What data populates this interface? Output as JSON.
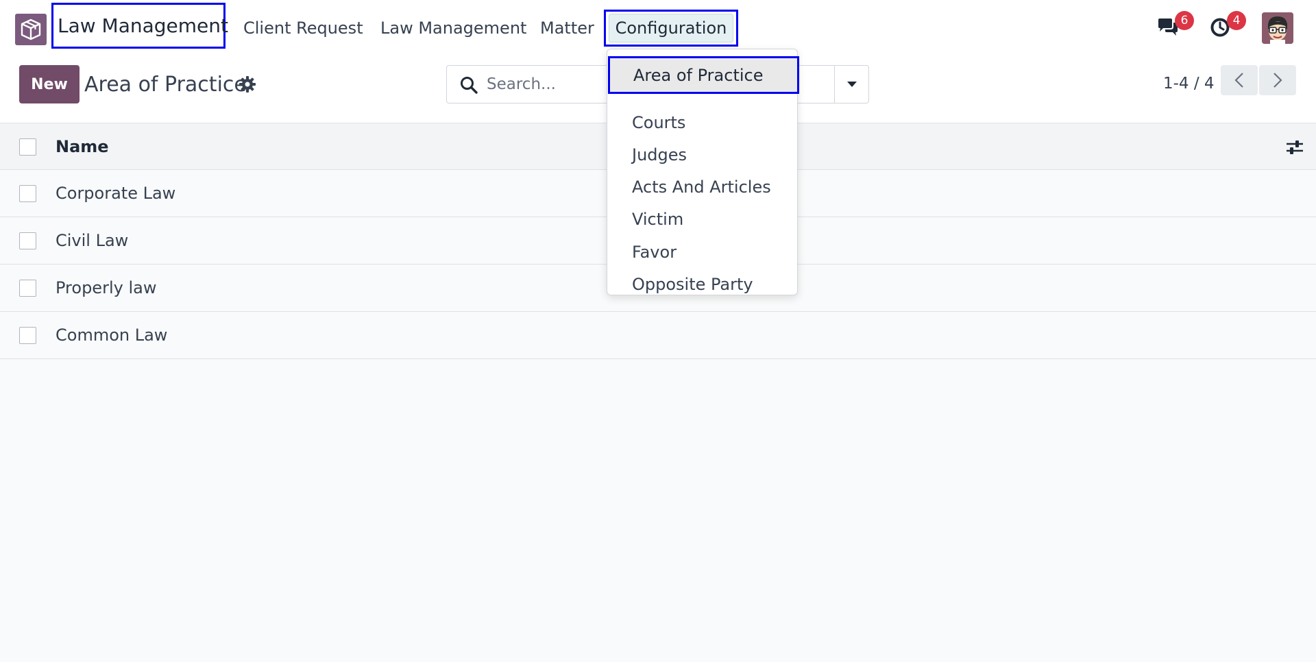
{
  "navbar": {
    "app_icon": "box-logo-icon",
    "brand": "Law Management",
    "menu": [
      {
        "label": "Client Request"
      },
      {
        "label": "Law Management"
      },
      {
        "label": "Matter"
      },
      {
        "label": "Configuration"
      }
    ],
    "messages_badge": "6",
    "activities_badge": "4",
    "icons": {
      "messages": "chat-bubbles-icon",
      "activities": "clock-icon",
      "avatar": "user-avatar"
    }
  },
  "control_panel": {
    "new_label": "New",
    "title": "Area of Practice",
    "search_placeholder": "Search...",
    "pager": "1-4 / 4"
  },
  "list": {
    "header": "Name",
    "rows": [
      {
        "name": "Corporate Law"
      },
      {
        "name": "Civil Law"
      },
      {
        "name": "Properly law"
      },
      {
        "name": "Common Law"
      }
    ]
  },
  "dropdown": {
    "items": [
      {
        "label": "Area of Practice"
      },
      {
        "label": "Courts"
      },
      {
        "label": "Judges"
      },
      {
        "label": "Acts And Articles"
      },
      {
        "label": "Victim"
      },
      {
        "label": "Favor"
      },
      {
        "label": "Opposite Party"
      }
    ]
  },
  "colors": {
    "primary": "#714b67",
    "highlight_border": "#0000ee",
    "badge": "#dc3545"
  }
}
